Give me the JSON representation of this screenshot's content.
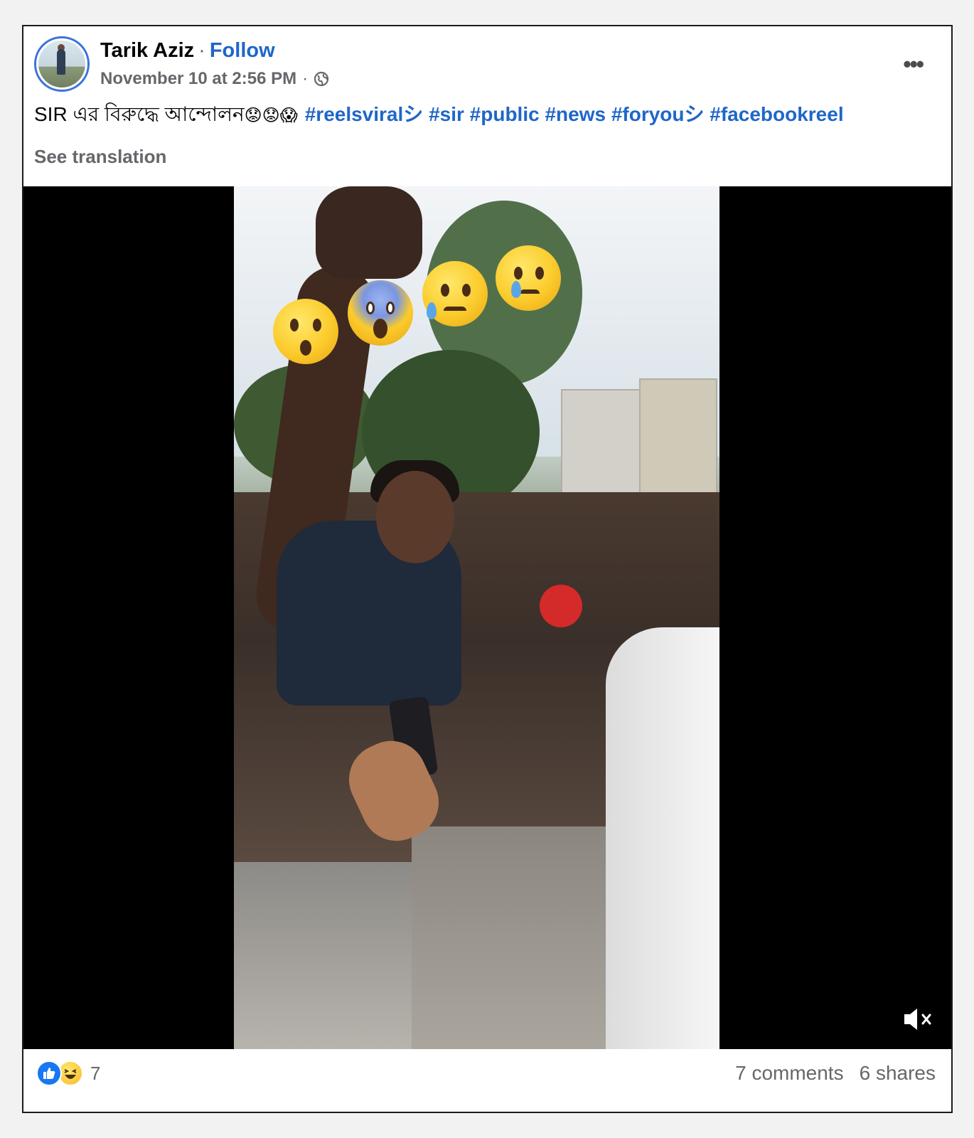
{
  "post": {
    "author": "Tarik Aziz",
    "separator": "·",
    "follow_label": "Follow",
    "timestamp": "November 10 at 2:56 PM",
    "meta_separator": "·",
    "privacy_icon": "globe-icon",
    "more_icon": "more-options-icon",
    "text_prefix": "SIR  এর বিরুদ্ধে আন্দোলন",
    "text_emojis": "😟😟😱",
    "hashtags": "#reelsviralシ #sir #public #news #foryouシ #facebookreel",
    "see_translation": "See translation"
  },
  "video": {
    "overlay_emojis": [
      "astonished-face",
      "face-screaming-in-fear",
      "sad-but-relieved-face",
      "crying-face"
    ],
    "mute_icon": "muted-speaker-icon"
  },
  "footer": {
    "reactions": [
      "like-icon",
      "haha-icon"
    ],
    "reaction_count": "7",
    "comments": "7 comments",
    "shares": "6 shares"
  },
  "colors": {
    "link_blue": "#1f66c9",
    "muted_text": "#65676b",
    "like_blue": "#1877f2"
  }
}
